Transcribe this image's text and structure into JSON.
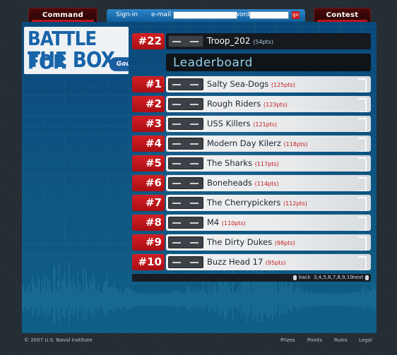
{
  "nav": {
    "left_tab": "Command Central",
    "right_tab": "Contest Home",
    "signin_label": "Sign-in",
    "email_label": "e-mail",
    "password_label": "password",
    "go_label": "go"
  },
  "logo": {
    "line1": "BATTLE FOR",
    "line2": "THE BOX",
    "badge": "Gouge"
  },
  "current_team": {
    "rank": "#22",
    "name": "Troop_202",
    "points": "(54pts)"
  },
  "leaderboard_title": "Leaderboard",
  "leaderboard": [
    {
      "rank": "#1",
      "name": "Salty Sea-Dogs",
      "points": "(125pts)"
    },
    {
      "rank": "#2",
      "name": "Rough Riders",
      "points": "(123pts)"
    },
    {
      "rank": "#3",
      "name": "USS Killers",
      "points": "(121pts)"
    },
    {
      "rank": "#4",
      "name": "Modern Day Kilerz",
      "points": "(118pts)"
    },
    {
      "rank": "#5",
      "name": "The Sharks",
      "points": "(117pts)"
    },
    {
      "rank": "#6",
      "name": "Boneheads",
      "points": "(114pts)"
    },
    {
      "rank": "#7",
      "name": "The Cherrypickers",
      "points": "(112pts)"
    },
    {
      "rank": "#8",
      "name": "M4",
      "points": "(110pts)"
    },
    {
      "rank": "#9",
      "name": "The Dirty Dukes",
      "points": "(98pts)"
    },
    {
      "rank": "#10",
      "name": "Buzz Head 17",
      "points": "(95pts)"
    }
  ],
  "pagination": {
    "back": "back",
    "pages": "3,4,5,6,7,8,9,10",
    "next": "next"
  },
  "footer": {
    "copyright": "© 2007 U.S. Naval Institute",
    "links": [
      "Prizes",
      "Points",
      "Rules",
      "Legal"
    ]
  }
}
